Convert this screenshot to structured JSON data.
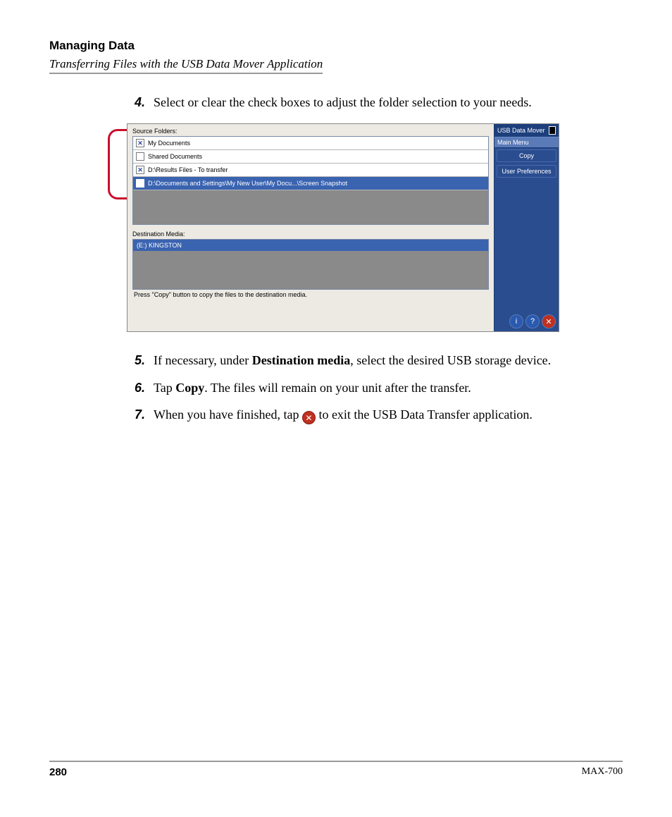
{
  "header": {
    "title": "Managing Data",
    "subtitle": "Transferring Files with the USB Data Mover Application"
  },
  "steps": {
    "s4": {
      "num": "4.",
      "text": "Select or clear the check boxes to adjust the folder selection to your needs."
    },
    "s5": {
      "num": "5.",
      "pre": "If necessary, under ",
      "bold": "Destination media",
      "post": ", select the desired USB storage device."
    },
    "s6": {
      "num": "6.",
      "pre": "Tap ",
      "bold": "Copy",
      "post": ". The files will remain on your unit after the transfer."
    },
    "s7": {
      "num": "7.",
      "pre": "When you have finished, tap ",
      "post": " to exit the USB Data Transfer application."
    }
  },
  "screenshot": {
    "source_label": "Source Folders:",
    "rows": {
      "r0": {
        "label": "My Documents",
        "checked": "✕"
      },
      "r1": {
        "label": "Shared Documents",
        "checked": ""
      },
      "r2": {
        "label": "D:\\Results Files - To transfer",
        "checked": "✕"
      },
      "r3": {
        "label": "D:\\Documents and Settings\\My New User\\My Docu...\\Screen Snapshot",
        "checked": ""
      }
    },
    "dest_label": "Destination Media:",
    "dest_row": "(E:) KINGSTON",
    "hint": "Press \"Copy\" button to copy the files to the destination media.",
    "app_title": "USB Data Mover",
    "main_menu": "Main Menu",
    "btn_copy": "Copy",
    "btn_prefs": "User Preferences"
  },
  "footer": {
    "page": "280",
    "model": "MAX-700"
  }
}
